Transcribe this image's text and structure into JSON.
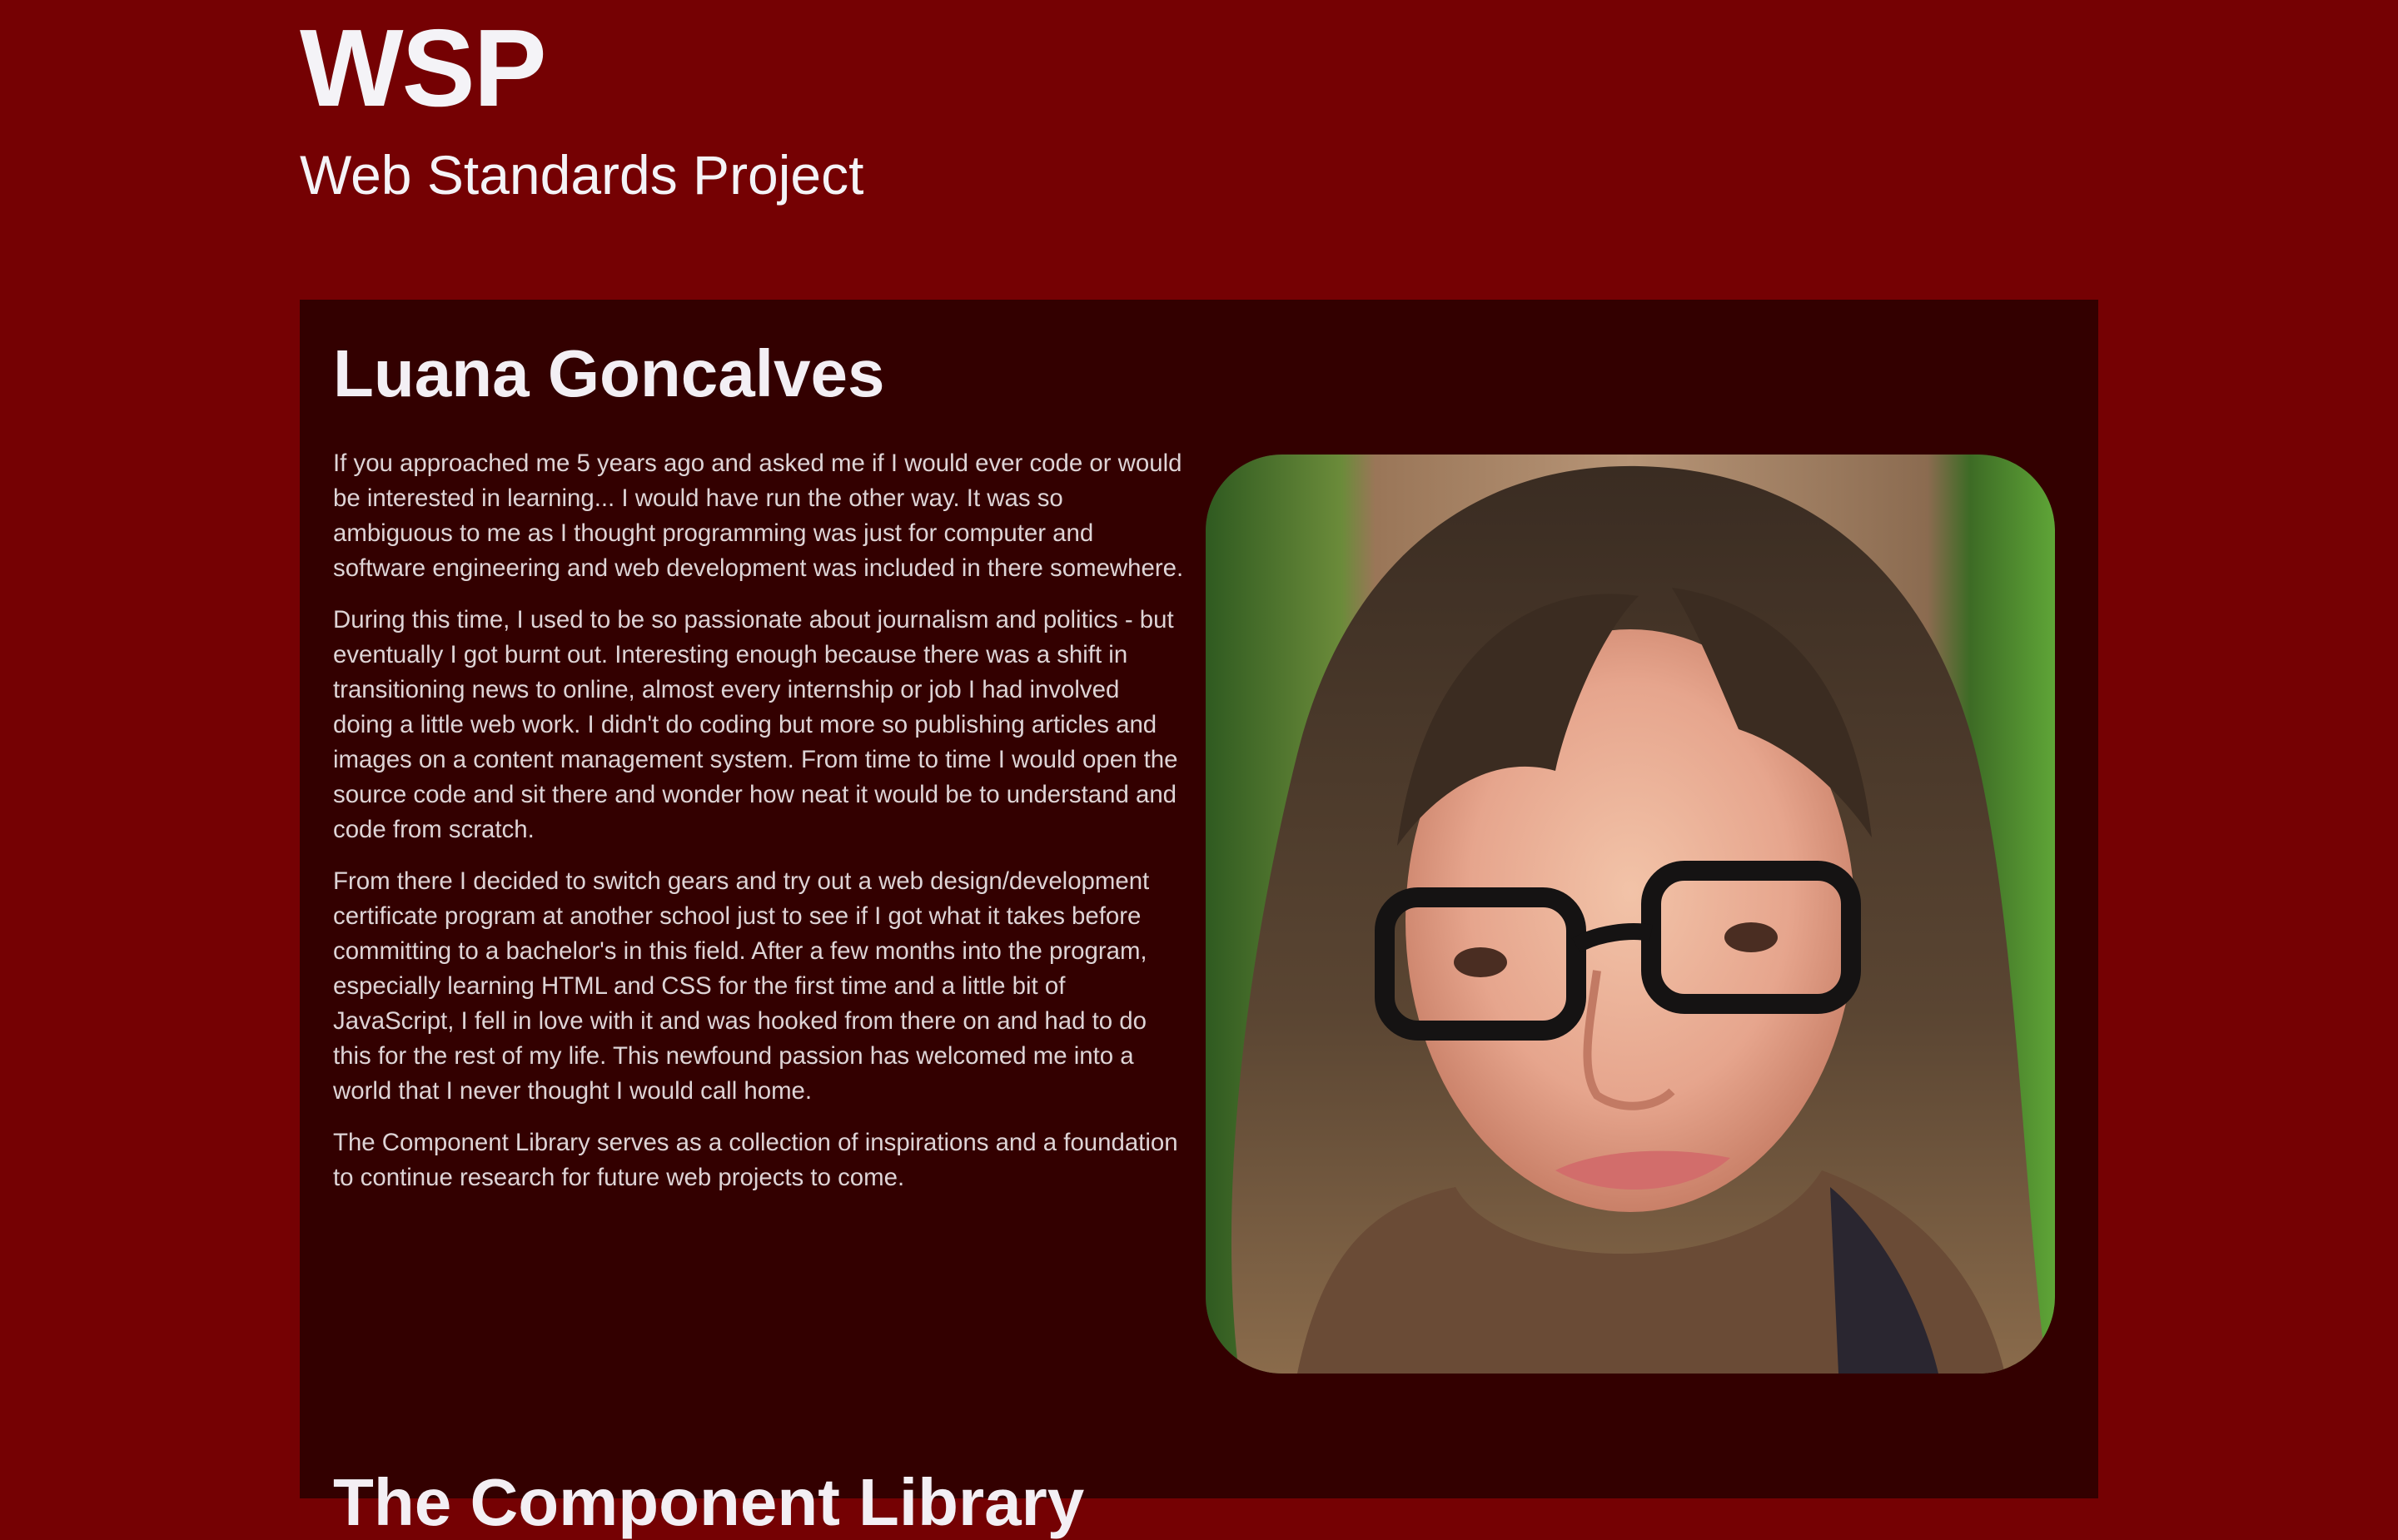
{
  "header": {
    "title": "WSP",
    "subtitle": "Web Standards Project"
  },
  "profile": {
    "name": "Luana Goncalves",
    "paragraphs": [
      "If you approached me 5 years ago and asked me if I would ever code or would be interested in learning... I would have run the other way. It was so ambiguous to me as I thought programming was just for computer and software engineering and web development was included in there somewhere.",
      "During this time, I used to be so passionate about journalism and politics - but eventually I got burnt out. Interesting enough because there was a shift in transitioning news to online, almost every internship or job I had involved doing a little web work. I didn't do coding but more so publishing articles and images on a content management system. From time to time I would open the source code and sit there and wonder how neat it would be to understand and code from scratch.",
      "From there I decided to switch gears and try out a web design/development certificate program at another school just to see if I got what it takes before committing to a bachelor's in this field. After a few months into the program, especially learning HTML and CSS for the first time and a little bit of JavaScript, I fell in love with it and was hooked from there on and had to do this for the rest of my life. This newfound passion has welcomed me into a world that I never thought I would call home.",
      "The Component Library serves as a collection of inspirations and a foundation to continue research for future web projects to come."
    ]
  },
  "next_section": {
    "title": "The Component Library"
  },
  "colors": {
    "page_background": "#750103",
    "panel_background": "#330000",
    "text_primary": "#f3eff4",
    "text_body": "#ded4d6"
  }
}
